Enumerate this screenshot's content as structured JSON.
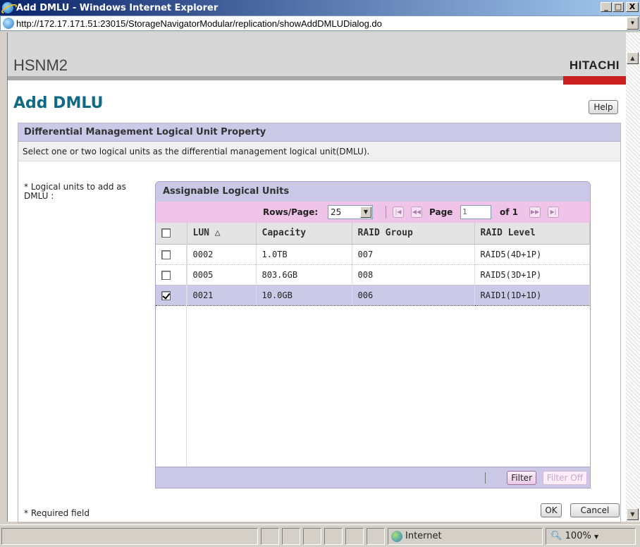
{
  "window": {
    "title": "Add DMLU - Windows Internet Explorer",
    "minimize": "_",
    "maximize": "□",
    "close": "X"
  },
  "address": {
    "url": "http://172.17.171.51:23015/StorageNavigatorModular/replication/showAddDMLUDialog.do"
  },
  "app": {
    "name": "HSNM2",
    "brand": "HITACHI"
  },
  "page": {
    "title": "Add DMLU",
    "help_label": "Help"
  },
  "panel": {
    "heading": "Differential Management Logical Unit Property",
    "description": "Select one or two logical units as the differential management logical unit(DMLU).",
    "field_label": "* Logical units to add as DMLU :",
    "required_note": "* Required field"
  },
  "grid": {
    "title": "Assignable Logical Units",
    "rows_per_page_label": "Rows/Page:",
    "rows_per_page": "25",
    "page_label": "Page",
    "page_value": "1",
    "of_label": "of 1",
    "columns": [
      "LUN △",
      "Capacity",
      "RAID Group",
      "RAID Level"
    ],
    "rows": [
      {
        "lun": "0002",
        "capacity": "1.0TB",
        "raid_group": "007",
        "raid_level": "RAID5(4D+1P)",
        "checked": false
      },
      {
        "lun": "0005",
        "capacity": "803.6GB",
        "raid_group": "008",
        "raid_level": "RAID5(3D+1P)",
        "checked": false
      },
      {
        "lun": "0021",
        "capacity": "10.0GB",
        "raid_group": "006",
        "raid_level": "RAID1(1D+1D)",
        "checked": true
      }
    ],
    "filter_label": "Filter",
    "filter_off_label": "Filter Off"
  },
  "actions": {
    "ok_label": "OK",
    "cancel_label": "Cancel"
  },
  "statusbar": {
    "zone": "Internet",
    "zoom": "100%"
  },
  "colors": {
    "title_accent": "#116a83",
    "brand_red": "#cc1f1f",
    "panel_header": "#ccc8e8",
    "pager_bg": "#f0c3e8"
  }
}
